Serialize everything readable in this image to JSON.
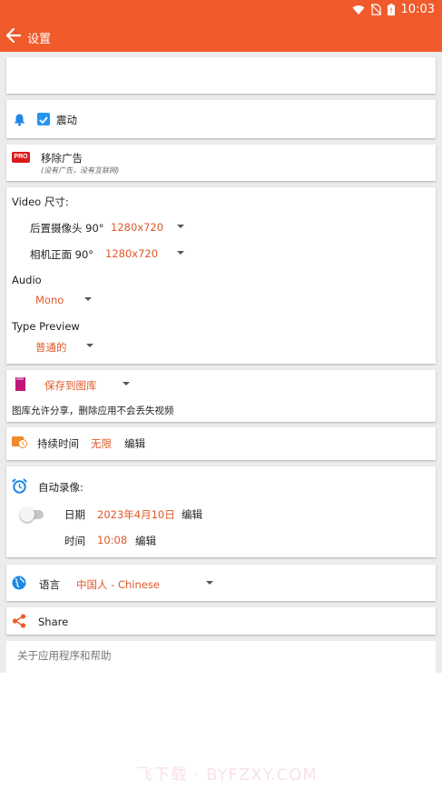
{
  "status_bar": {
    "time": "10:03"
  },
  "header": {
    "title": "设置"
  },
  "vibrate": {
    "label": "震动",
    "checked": true
  },
  "remove_ads": {
    "badge": "PRO",
    "title": "移除广告",
    "subtitle": "(没有广告，没有互联网)"
  },
  "video": {
    "heading": "Video 尺寸:",
    "rear_label": "后置摄像头 90°",
    "rear_value": "1280x720",
    "front_label": "相机正面 90°",
    "front_value": "1280x720"
  },
  "audio": {
    "heading": "Audio",
    "value": "Mono"
  },
  "type_preview": {
    "heading": "Type Preview",
    "value": "普通的"
  },
  "storage": {
    "value": "保存到图库",
    "note": "图库允许分享，删除应用不会丢失视频"
  },
  "duration": {
    "label": "持续时间",
    "value": "无限",
    "edit": "编辑"
  },
  "auto_record": {
    "heading": "自动录像:",
    "date_label": "日期",
    "date_value": "2023年4月10日",
    "date_edit": "编辑",
    "time_label": "时间",
    "time_value": "10:08",
    "time_edit": "编辑",
    "enabled": false
  },
  "language": {
    "label": "语言",
    "value": "中国人 - Chinese"
  },
  "share": {
    "label": "Share"
  },
  "about": {
    "label": "关于应用程序和帮助"
  },
  "watermark": "飞下载 · BYFZXY.COM",
  "colors": {
    "accent": "#f15a2b",
    "value_text": "#e0592a",
    "icon_blue": "#1e88e5"
  }
}
